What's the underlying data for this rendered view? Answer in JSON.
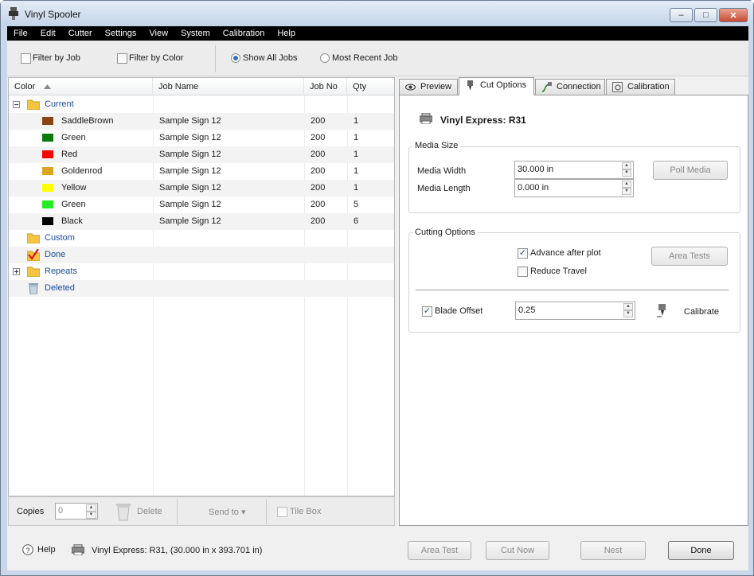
{
  "window": {
    "title": "Vinyl Spooler",
    "min": "–",
    "max": "□",
    "close": "✕"
  },
  "menu": [
    "File",
    "Edit",
    "Cutter",
    "Settings",
    "View",
    "System",
    "Calibration",
    "Help"
  ],
  "toolbar": {
    "filter_job": "Filter by Job",
    "filter_color": "Filter by Color",
    "show_all": "Show All Jobs",
    "most_recent": "Most Recent Job"
  },
  "table": {
    "headers": {
      "color": "Color",
      "job": "Job Name",
      "jobno": "Job No",
      "qty": "Qty"
    },
    "groups": {
      "current": "Current",
      "custom": "Custom",
      "done": "Done",
      "repeats": "Repeats",
      "deleted": "Deleted"
    },
    "rows": [
      {
        "color": "SaddleBrown",
        "swatch": "#8B4513",
        "job": "Sample Sign 12",
        "no": "200",
        "qty": "1"
      },
      {
        "color": "Green",
        "swatch": "#0a7a0a",
        "job": "Sample Sign 12",
        "no": "200",
        "qty": "1"
      },
      {
        "color": "Red",
        "swatch": "#ff0000",
        "job": "Sample Sign 12",
        "no": "200",
        "qty": "1"
      },
      {
        "color": "Goldenrod",
        "swatch": "#DAA520",
        "job": "Sample Sign 12",
        "no": "200",
        "qty": "1"
      },
      {
        "color": "Yellow",
        "swatch": "#ffff00",
        "job": "Sample Sign 12",
        "no": "200",
        "qty": "1"
      },
      {
        "color": "Green",
        "swatch": "#22ee22",
        "job": "Sample Sign 12",
        "no": "200",
        "qty": "5"
      },
      {
        "color": "Black",
        "swatch": "#000000",
        "job": "Sample Sign 12",
        "no": "200",
        "qty": "6"
      }
    ]
  },
  "bottom_left": {
    "copies_label": "Copies",
    "copies_value": "0",
    "delete": "Delete",
    "send_to": "Send to ▾",
    "tile_box": "Tile Box"
  },
  "tabs": {
    "preview": "Preview",
    "cut_options": "Cut Options",
    "connection": "Connection",
    "calibration": "Calibration"
  },
  "cut": {
    "device": "Vinyl Express: R31",
    "media_size": "Media Size",
    "media_width_label": "Media Width",
    "media_width": "30.000 in",
    "media_length_label": "Media Length",
    "media_length": "0.000 in",
    "poll_media": "Poll Media",
    "cutting_options": "Cutting Options",
    "advance": "Advance after plot",
    "reduce": "Reduce Travel",
    "area_tests": "Area Tests",
    "blade_offset_label": "Blade Offset",
    "blade_offset": "0.25",
    "calibrate": "Calibrate"
  },
  "status": {
    "help": "Help",
    "device": "Vinyl Express: R31,  (30.000 in x 393.701 in)",
    "area_test": "Area Test",
    "cut_now": "Cut Now",
    "nest": "Nest",
    "done": "Done"
  }
}
